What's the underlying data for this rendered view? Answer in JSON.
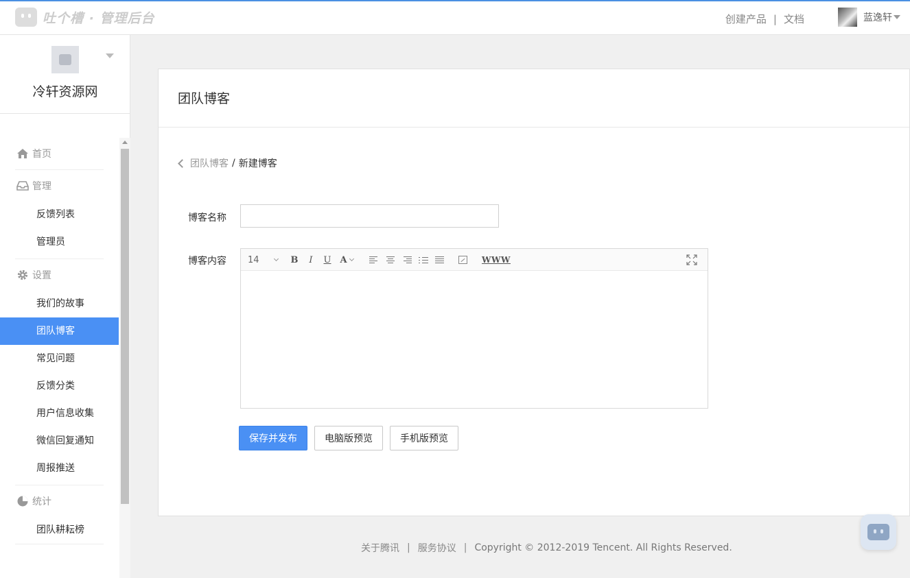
{
  "header": {
    "logo_text": "吐个槽 · 管理后台",
    "links": [
      "创建产品",
      "文档"
    ],
    "separator": "|",
    "user_name": "蓝逸轩"
  },
  "sidebar": {
    "product_name": "冷轩资源网",
    "groups": [
      {
        "label": "首页",
        "icon": "home-icon",
        "items": []
      },
      {
        "label": "管理",
        "icon": "inbox-icon",
        "items": [
          "反馈列表",
          "管理员"
        ]
      },
      {
        "label": "设置",
        "icon": "gear-icon",
        "items": [
          "我们的故事",
          "团队博客",
          "常见问题",
          "反馈分类",
          "用户信息收集",
          "微信回复通知",
          "周报推送"
        ]
      },
      {
        "label": "统计",
        "icon": "pie-chart-icon",
        "items": [
          "团队耕耘榜"
        ]
      }
    ],
    "active_item": "团队博客"
  },
  "main": {
    "title": "团队博客",
    "breadcrumb": {
      "parent": "团队博客",
      "separator": "/",
      "current": "新建博客"
    },
    "form": {
      "name_label": "博客名称",
      "name_value": "",
      "content_label": "博客内容",
      "editor": {
        "font_size": "14",
        "bold": "B",
        "italic": "I",
        "underline": "U",
        "color": "A",
        "link": "WWW"
      }
    },
    "buttons": {
      "save": "保存并发布",
      "pc_preview": "电脑版预览",
      "mobile_preview": "手机版预览"
    }
  },
  "footer": {
    "about": "关于腾讯",
    "terms": "服务协议",
    "separator": "|",
    "copyright": "Copyright © 2012-2019 Tencent. All Rights Reserved."
  },
  "colors": {
    "accent": "#4a90f4",
    "top_border": "#4a90e2"
  }
}
